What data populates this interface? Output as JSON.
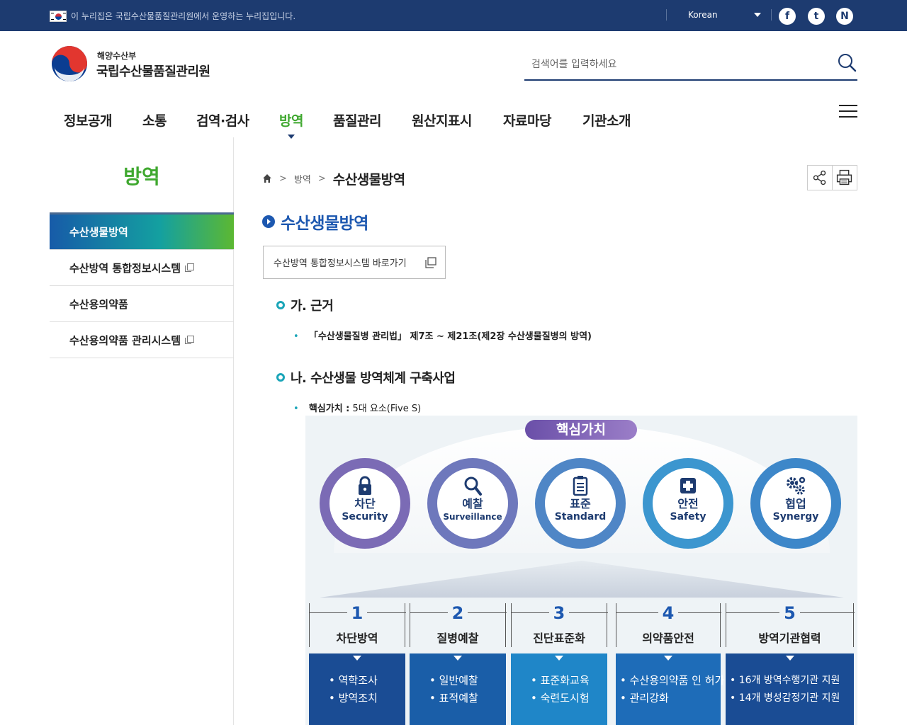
{
  "topbar": {
    "notice": "이 누리집은 국립수산물품질관리원에서 운영하는 누리집입니다.",
    "language": "Korean",
    "sns": [
      {
        "name": "facebook-icon",
        "glyph": "f"
      },
      {
        "name": "twitter-icon",
        "glyph": "t"
      },
      {
        "name": "naver-icon",
        "glyph": "N"
      }
    ]
  },
  "header": {
    "logo_sub": "해양수산부",
    "logo_main": "국립수산물품질관리원",
    "search_placeholder": "검색어를 입력하세요"
  },
  "gnb": {
    "items": [
      "정보공개",
      "소통",
      "검역·검사",
      "방역",
      "품질관리",
      "원산지표시",
      "자료마당",
      "기관소개"
    ],
    "active_index": 3
  },
  "lnb": {
    "title": "방역",
    "items": [
      {
        "label": "수산생물방역",
        "external": false,
        "active": true
      },
      {
        "label": "수산방역 통합정보시스템",
        "external": true,
        "active": false
      },
      {
        "label": "수산용의약품",
        "external": false,
        "active": false
      },
      {
        "label": "수산용의약품 관리시스템",
        "external": true,
        "active": false
      }
    ]
  },
  "breadcrumb": {
    "items": [
      "방역"
    ],
    "current": "수산생물방역"
  },
  "content": {
    "title": "수산생물방역",
    "shortcut_label": "수산방역 통합정보시스템 바로가기",
    "section1": {
      "heading": "가. 근거",
      "bullet": "「수산생물질병 관리법」 제7조 ~ 제21조(제2장 수산생물질병의 방역)"
    },
    "section2": {
      "heading": "나. 수산생물 방역체계 구축사업",
      "bullet_bold": "핵심가치 :",
      "bullet_text": " 5대 요소(Five S)"
    }
  },
  "infographic": {
    "title": "핵심가치",
    "values": [
      {
        "kr": "차단",
        "en": "Security",
        "icon": "lock-icon",
        "color": "#7b6bb5"
      },
      {
        "kr": "예찰",
        "en": "Surveillance",
        "icon": "magnifier-icon",
        "color": "#6e78bc"
      },
      {
        "kr": "표준",
        "en": "Standard",
        "icon": "clipboard-icon",
        "color": "#4f86c6"
      },
      {
        "kr": "안전",
        "en": "Safety",
        "icon": "medical-cross-icon",
        "color": "#3c96cf"
      },
      {
        "kr": "협업",
        "en": "Synergy",
        "icon": "gears-icon",
        "color": "#3d87c9"
      }
    ],
    "columns": [
      {
        "num": "1",
        "name": "차단방역",
        "items": [
          "• 역학조사",
          "• 방역조치"
        ],
        "color": "#1a4c94"
      },
      {
        "num": "2",
        "name": "질병예찰",
        "items": [
          "• 일반예찰",
          "• 표적예찰"
        ],
        "color": "#1a5ea8"
      },
      {
        "num": "3",
        "name": "진단표준화",
        "items": [
          "• 표준화교육",
          "• 숙련도시험"
        ],
        "color": "#1f86c8"
      },
      {
        "num": "4",
        "name": "의약품안전",
        "items": [
          "• 수산용의약품 인 허가",
          "• 관리강화"
        ],
        "color": "#1e6cb8"
      },
      {
        "num": "5",
        "name": "방역기관협력",
        "items": [
          "• 16개 방역수행기관 지원",
          "• 14개 병성감정기관 지원"
        ],
        "color": "#1a4c94"
      }
    ]
  }
}
